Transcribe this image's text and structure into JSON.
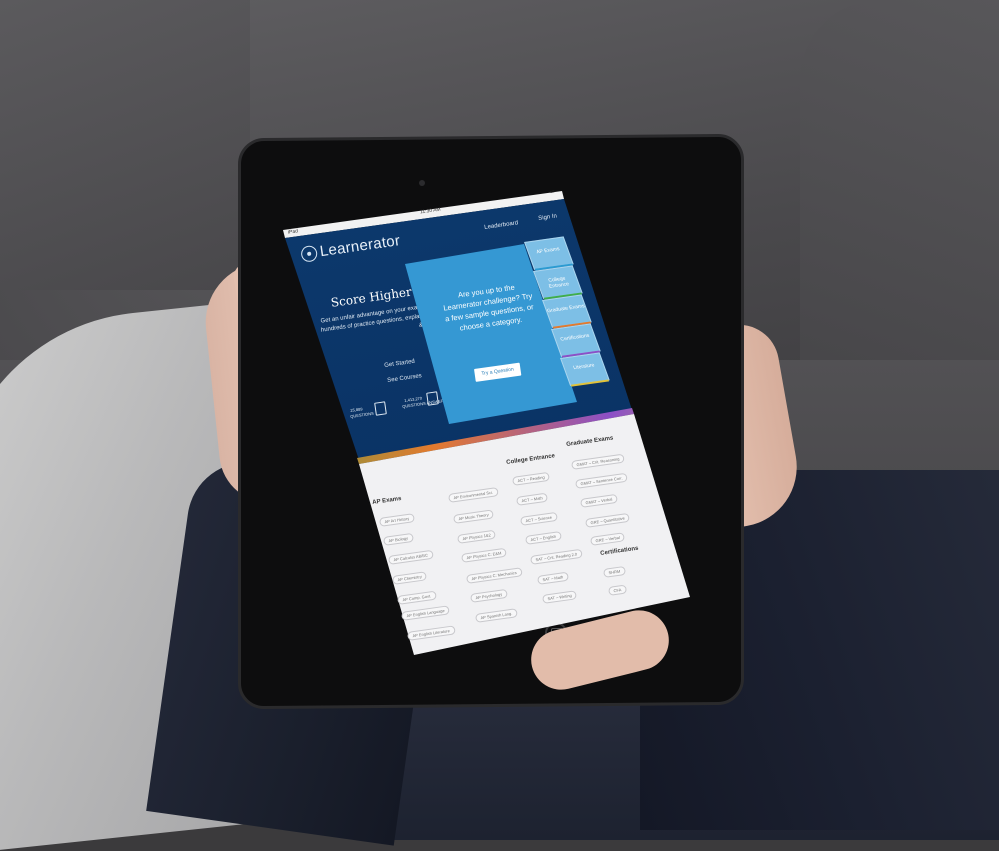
{
  "status_bar": {
    "carrier": "iPad",
    "time": "11:30 AM",
    "battery": "▭"
  },
  "header": {
    "brand": "Learnerator",
    "nav": [
      {
        "label": "Leaderboard"
      },
      {
        "label": "Sign In"
      }
    ]
  },
  "hero": {
    "title": "Score Higher",
    "copy": "Get an unfair advantage on your exams with hundreds of practice questions, explanations & more.",
    "links": [
      {
        "label": "Get Started"
      },
      {
        "label": "See Courses"
      }
    ],
    "stats": [
      {
        "value": "25,889",
        "label": "QUESTIONS"
      },
      {
        "value": "1,413,270",
        "label": "QUESTIONS ANSWERED"
      }
    ]
  },
  "challenge": {
    "text": "Are you up to the Learnerator challenge? Try a few sample questions, or choose a category.",
    "button": "Try a Question"
  },
  "categories": [
    {
      "label": "AP Exams",
      "color": "#2b9bd2"
    },
    {
      "label": "College Entrance",
      "color": "#3fae4b"
    },
    {
      "label": "Graduate Exams",
      "color": "#e37a2e"
    },
    {
      "label": "Certifications",
      "color": "#8c4fc7"
    },
    {
      "label": "Literature",
      "color": "#e0c23a"
    }
  ],
  "course_lists": {
    "ap_exams": {
      "heading": "AP Exams",
      "col1": [
        "AP Art History",
        "AP Biology",
        "AP Calculus AB/BC",
        "AP Chemistry",
        "AP Comp. Govt.",
        "AP English Language",
        "AP English Literature"
      ],
      "col2": [
        "AP Environmental Sci.",
        "AP Music Theory",
        "AP Physics 1&2",
        "AP Physics C: E&M",
        "AP Physics C: Mechanics",
        "AP Psychology",
        "AP Spanish Lang."
      ]
    },
    "college_entrance": {
      "heading": "College Entrance",
      "items": [
        "ACT – Reading",
        "ACT – Math",
        "ACT – Science",
        "ACT – English",
        "SAT – Crit. Reading 2.0",
        "SAT – Math",
        "SAT – Writing"
      ]
    },
    "graduate_exams": {
      "heading": "Graduate Exams",
      "items": [
        "GMAT – Crit. Reasoning",
        "GMAT – Sentence Corr.",
        "GMAT – Verbal",
        "GRE – Quantitative",
        "GRE – Verbal"
      ]
    },
    "certifications": {
      "heading": "Certifications",
      "items": [
        "SHRM",
        "CFA"
      ]
    }
  }
}
